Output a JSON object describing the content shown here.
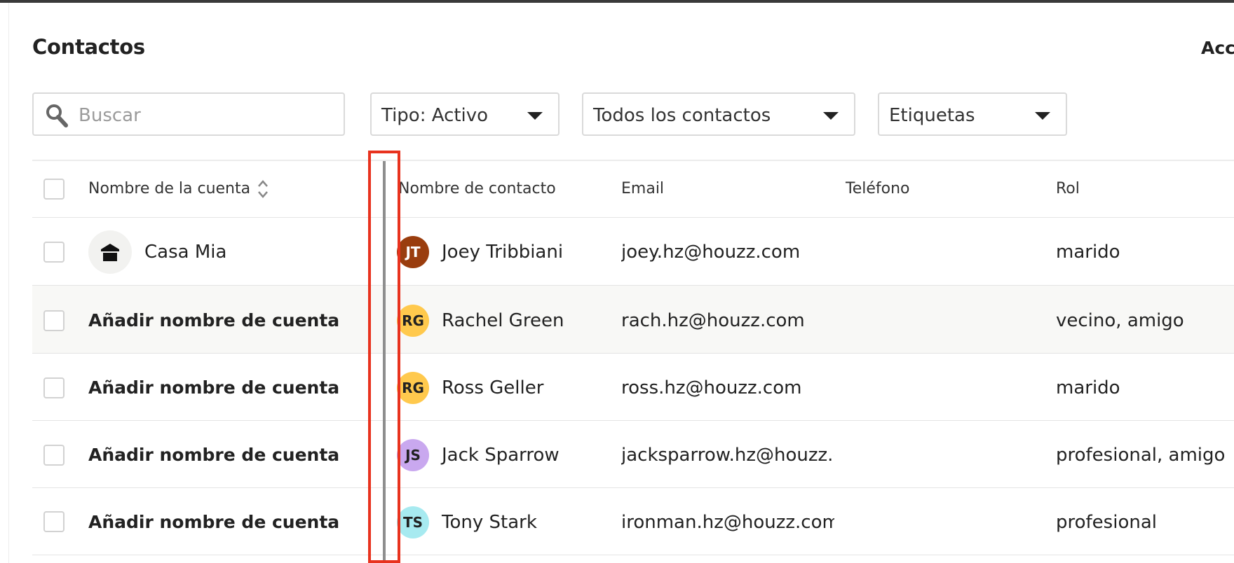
{
  "page": {
    "title": "Contactos",
    "header_action": "Acc"
  },
  "filters": {
    "search_placeholder": "Buscar",
    "type": "Tipo: Activo",
    "scope": "Todos los contactos",
    "tags": "Etiquetas"
  },
  "table": {
    "headers": {
      "account": "Nombre de la cuenta",
      "contact": "Nombre de contacto",
      "email": "Email",
      "phone": "Teléfono",
      "role": "Rol"
    },
    "rows": [
      {
        "account": "Casa Mia",
        "initials": "JT",
        "contact": "Joey Tribbiani",
        "email": "joey.hz@houzz.com",
        "phone": "",
        "role": "marido"
      },
      {
        "account": "Añadir nombre de cuenta",
        "initials": "RG",
        "contact": "Rachel Green",
        "email": "rach.hz@houzz.com",
        "phone": "",
        "role": "vecino, amigo"
      },
      {
        "account": "Añadir nombre de cuenta",
        "initials": "RG",
        "contact": "Ross Geller",
        "email": "ross.hz@houzz.com",
        "phone": "",
        "role": "marido"
      },
      {
        "account": "Añadir nombre de cuenta",
        "initials": "JS",
        "contact": "Jack Sparrow",
        "email": "jacksparrow.hz@houzz.com",
        "phone": "",
        "role": "profesional, amigo"
      },
      {
        "account": "Añadir nombre de cuenta",
        "initials": "TS",
        "contact": "Tony Stark",
        "email": "ironman.hz@houzz.com",
        "phone": "",
        "role": "profesional"
      }
    ]
  },
  "colors": {
    "highlight": "#e8321e",
    "avatar_jt": "#9a3d0e",
    "avatar_rg": "#ffc94d",
    "avatar_js": "#c9a8ef",
    "avatar_ts": "#a7eaf0"
  },
  "icons": {
    "search": "search-icon",
    "house": "house-icon",
    "sort": "sort-icon",
    "caret": "chevron-down-icon"
  }
}
